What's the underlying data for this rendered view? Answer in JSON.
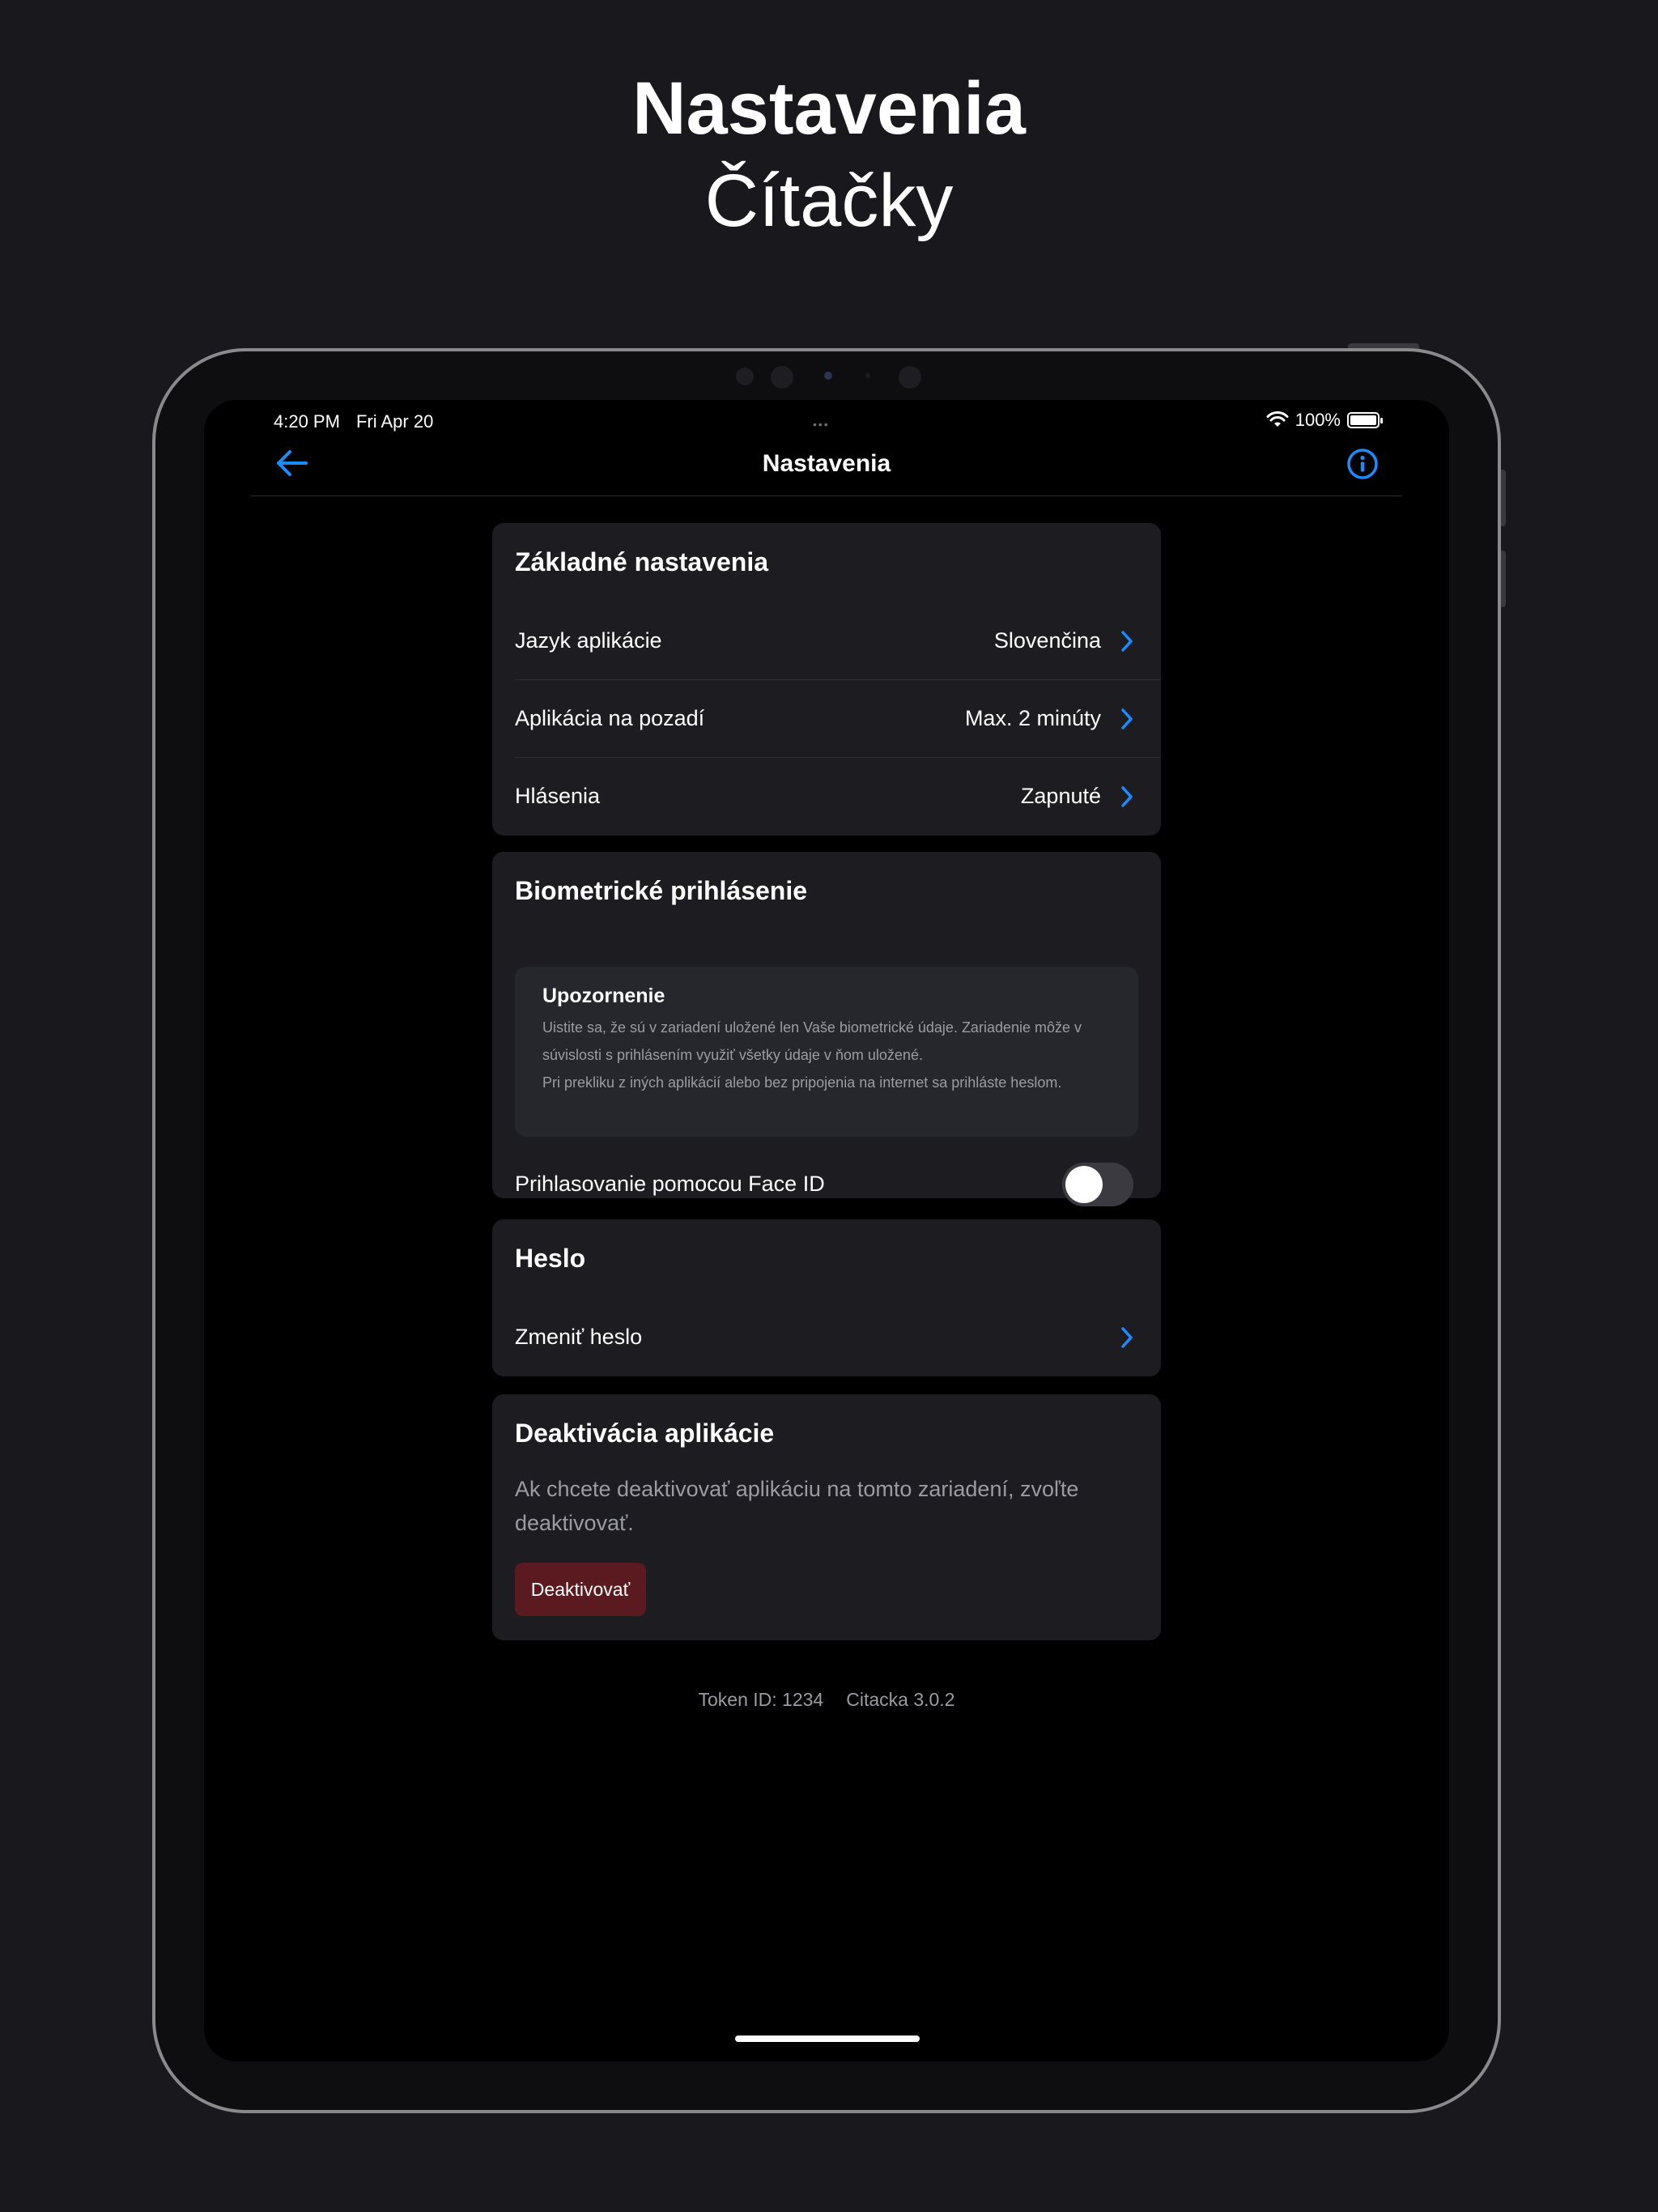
{
  "promo": {
    "title": "Nastavenia",
    "subtitle": "Čítačky"
  },
  "status_bar": {
    "time": "4:20 PM",
    "date": "Fri Apr 20",
    "dots": "•••",
    "battery": "100%"
  },
  "nav": {
    "title": "Nastavenia",
    "back_icon": "arrow-left-icon",
    "info_icon": "info-circle-icon",
    "accent_color": "#1a8cff"
  },
  "basic_settings": {
    "title": "Základné nastavenia",
    "rows": [
      {
        "label": "Jazyk aplikácie",
        "value": "Slovenčina"
      },
      {
        "label": "Aplikácia na pozadí",
        "value": "Max. 2 minúty"
      },
      {
        "label": "Hlásenia",
        "value": "Zapnuté"
      }
    ]
  },
  "biometric": {
    "title": "Biometrické prihlásenie",
    "warning_title": "Upozornenie",
    "warning_line1": "Uistite sa, že sú v zariadení uložené len Vaše biometrické údaje. Zariadenie môže v súvislosti s prihlásením využiť všetky údaje v ňom uložené.",
    "warning_line2": "Pri prekliku z iných aplikácií alebo bez pripojenia na internet sa prihláste heslom.",
    "toggle_label": "Prihlasovanie pomocou Face ID",
    "toggle_on": false
  },
  "password": {
    "title": "Heslo",
    "change_label": "Zmeniť heslo"
  },
  "deactivation": {
    "title": "Deaktivácia aplikácie",
    "text": "Ak chcete deaktivovať aplikáciu na tomto zariadení, zvoľte deaktivovať.",
    "button_label": "Deaktivovať",
    "button_color": "#5a1a20"
  },
  "footer": {
    "token": "Token ID: 1234",
    "version": "Citacka 3.0.2"
  }
}
